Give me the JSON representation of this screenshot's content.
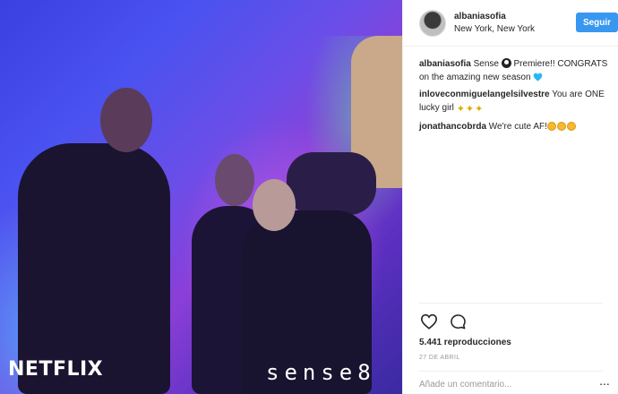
{
  "media": {
    "watermark_left": "NETFLIX",
    "watermark_right": "sense8"
  },
  "header": {
    "username": "albaniasofia",
    "location": "New York, New York",
    "follow_label": "Seguir"
  },
  "comments": [
    {
      "user": "albaniasofia",
      "parts": [
        {
          "type": "text",
          "value": "Sense "
        },
        {
          "type": "emoji",
          "icon": "8-ball-icon"
        },
        {
          "type": "text",
          "value": " Premiere!! CONGRATS on the amazing new season "
        },
        {
          "type": "emoji",
          "icon": "blue-heart-icon"
        }
      ]
    },
    {
      "user": "inloveconmiguelangelsilvestre",
      "parts": [
        {
          "type": "text",
          "value": "You are ONE lucky girl "
        },
        {
          "type": "emoji",
          "icon": "sparkles-icon"
        },
        {
          "type": "emoji",
          "icon": "sparkles-icon"
        },
        {
          "type": "emoji",
          "icon": "sparkles-icon"
        }
      ]
    },
    {
      "user": "jonathancobrda",
      "parts": [
        {
          "type": "text",
          "value": "We're cute AF!"
        },
        {
          "type": "emoji",
          "icon": "smirk-face-icon"
        },
        {
          "type": "emoji",
          "icon": "smirk-face-icon"
        },
        {
          "type": "emoji",
          "icon": "smirk-face-icon"
        }
      ]
    }
  ],
  "actions": {
    "like_icon": "heart-outline-icon",
    "comment_icon": "comment-bubble-icon",
    "views": "5.441 reproducciones",
    "date": "27 de abril"
  },
  "comment_box": {
    "placeholder": "Añade un comentario...",
    "more_label": "..."
  },
  "colors": {
    "accent": "#3897f0",
    "text": "#262626",
    "muted": "#999999",
    "heart_blue": "#29b6f6"
  }
}
